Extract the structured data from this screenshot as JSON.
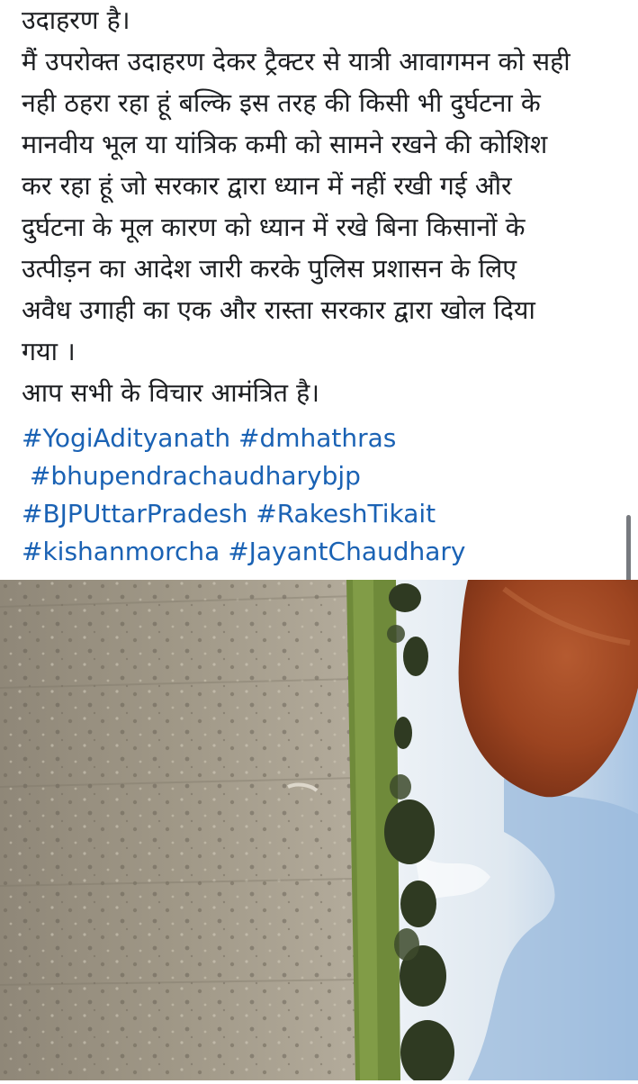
{
  "post": {
    "lines": [
      "उदाहरण है।",
      "मैं उपरोक्त उदाहरण देकर ट्रैक्टर से यात्री आवागमन को सही",
      "नही ठहरा रहा हूं बल्कि इस तरह की किसी भी दुर्घटना के",
      "मानवीय भूल या यांत्रिक कमी को सामने रखने की कोशिश",
      "कर रहा हूं जो सरकार द्वारा ध्यान में नहीं रखी गई और",
      "दुर्घटना के  मूल कारण को ध्यान में रखे बिना किसानों के",
      "उत्पीड़न का आदेश जारी करके पुलिस प्रशासन के लिए",
      "अवैध उगाही का एक और रास्ता सरकार द्वारा खोल दिया",
      "गया ।",
      "आप सभी के विचार आमंत्रित है।"
    ],
    "hashtags": [
      "#YogiAdityanath",
      "#dmhathras",
      "#bhupendrachaudharybjp",
      "#BJPUttarPradesh",
      "#RakeshTikait",
      "#kishanmorcha",
      "#JayantChaudhary"
    ]
  },
  "colors": {
    "text": "#1c1e21",
    "hashtag": "#1a62b4",
    "background": "#ffffff"
  },
  "media": {
    "type": "video-frame",
    "icon": "video-thumbnail"
  }
}
